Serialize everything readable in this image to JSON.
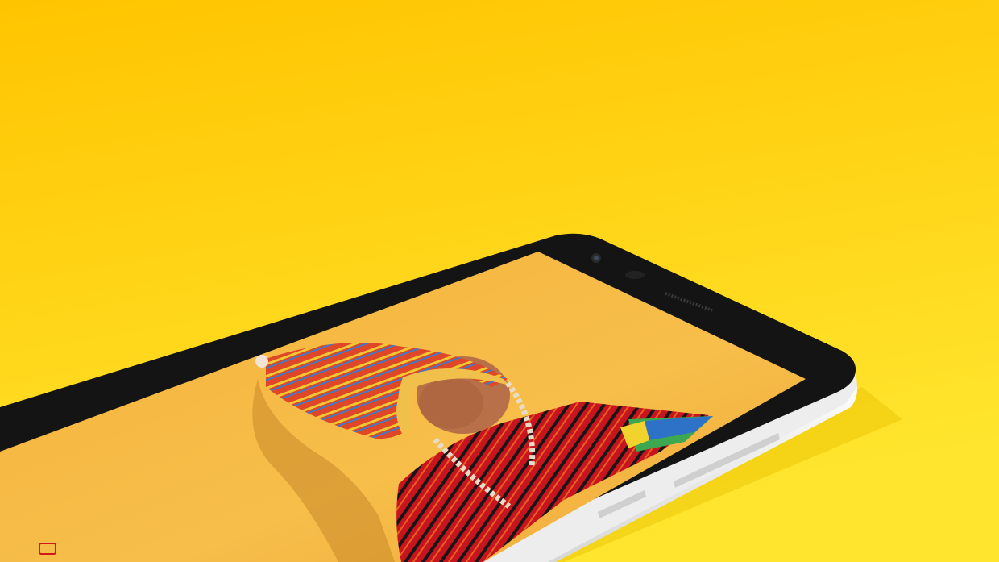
{
  "scene": {
    "background_top": "#FFC400",
    "background_bottom": "#FFE52E",
    "device_bezel": "#141414",
    "device_body": "#F2F2F2",
    "screen_backdrop": "#F4B43C",
    "nav_key_color": "#D01818"
  },
  "icons": {
    "front_camera": "camera-lens-icon",
    "proximity_sensor": "sensor-icon",
    "earpiece": "speaker-grille-icon",
    "nav_key": "square-outline-icon"
  }
}
